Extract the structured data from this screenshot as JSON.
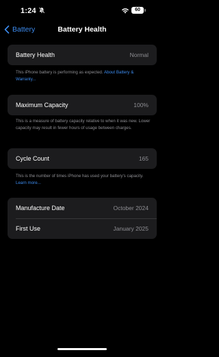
{
  "status_bar": {
    "time": "1:24",
    "battery_level": "60"
  },
  "nav": {
    "back_label": "Battery",
    "title": "Battery Health"
  },
  "battery_health": {
    "label": "Battery Health",
    "value": "Normal",
    "footnote_text": "This iPhone battery is performing as expected. ",
    "footnote_link": "About Battery & Warranty..."
  },
  "maximum_capacity": {
    "label": "Maximum Capacity",
    "value": "100%",
    "footnote_text": "This is a measure of battery capacity relative to when it was new. Lower capacity may result in fewer hours of usage between charges."
  },
  "cycle_count": {
    "label": "Cycle Count",
    "value": "165",
    "footnote_text": "This is the number of times iPhone has used your battery's capacity. ",
    "footnote_link": "Learn more..."
  },
  "dates": {
    "manufacture_label": "Manufacture Date",
    "manufacture_value": "October 2024",
    "first_use_label": "First Use",
    "first_use_value": "January 2025"
  },
  "colors": {
    "accent": "#3d8cf0",
    "group_background": "#1c1c1e",
    "secondary_text": "#8e8e93"
  }
}
